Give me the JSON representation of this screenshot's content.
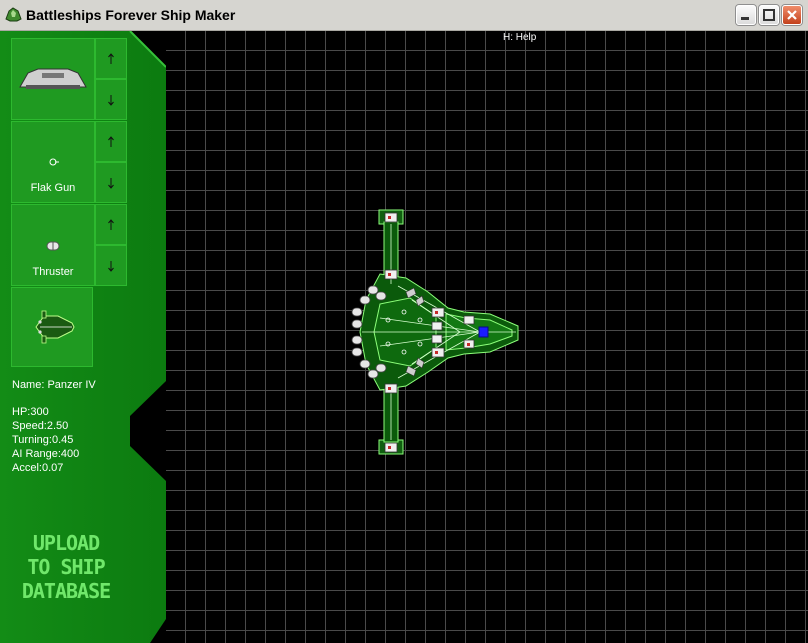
{
  "window": {
    "title": "Battleships Forever Ship Maker"
  },
  "slots": [
    {
      "label": "",
      "icon": "hull-icon"
    },
    {
      "label": "Flak Gun",
      "icon": "flak-gun-icon"
    },
    {
      "label": "Thruster",
      "icon": "thruster-icon"
    },
    {
      "label": "",
      "icon": "ship-preview-icon"
    }
  ],
  "ship": {
    "name_line": "Name: Panzer IV",
    "hp": "HP:300",
    "speed": "Speed:2.50",
    "turning": "Turning:0.45",
    "ai_range": "AI Range:400",
    "accel": "Accel:0.07"
  },
  "upload": {
    "line1": "UPLOAD",
    "line2": "TO SHIP",
    "line3": "DATABASE"
  },
  "help_text": "H: Help",
  "colors": {
    "panel": "#0f8a12",
    "slot": "#1f9a21",
    "grid_line": "#4a4a4a",
    "ship_line": "#8cff7a"
  }
}
